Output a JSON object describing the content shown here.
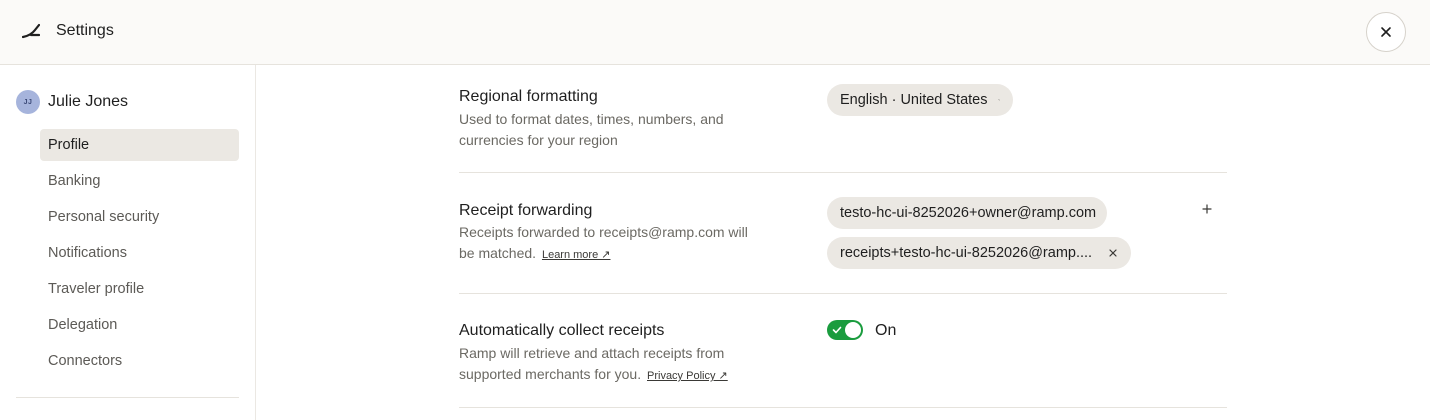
{
  "header": {
    "title": "Settings",
    "logo_icon": "ramp-logo-icon",
    "close_icon": "close-icon"
  },
  "sidebar": {
    "user": {
      "initials": "JJ",
      "name": "Julie Jones"
    },
    "items": [
      {
        "label": "Profile",
        "active": true
      },
      {
        "label": "Banking",
        "active": false
      },
      {
        "label": "Personal security",
        "active": false
      },
      {
        "label": "Notifications",
        "active": false
      },
      {
        "label": "Traveler profile",
        "active": false
      },
      {
        "label": "Delegation",
        "active": false
      },
      {
        "label": "Connectors",
        "active": false
      }
    ]
  },
  "sections": {
    "regional": {
      "title": "Regional formatting",
      "description": "Used to format dates, times, numbers, and currencies for your region",
      "selected_value": "English · United States"
    },
    "receipt_forwarding": {
      "title": "Receipt forwarding",
      "description": "Receipts forwarded to receipts@ramp.com will be matched.",
      "link_label": "Learn more ↗",
      "emails": [
        "testo-hc-ui-8252026+owner@ramp.com",
        "receipts+testo-hc-ui-8252026@ramp...."
      ]
    },
    "auto_collect": {
      "title": "Automatically collect receipts",
      "description": "Ramp will retrieve and attach receipts from supported merchants for you.",
      "link_label": "Privacy Policy ↗",
      "toggle_on": true,
      "toggle_label": "On"
    }
  },
  "colors": {
    "toggle_on": "#1a9c3e",
    "pill_bg": "#ebe8e3",
    "avatar_bg": "#a6b4dc"
  }
}
